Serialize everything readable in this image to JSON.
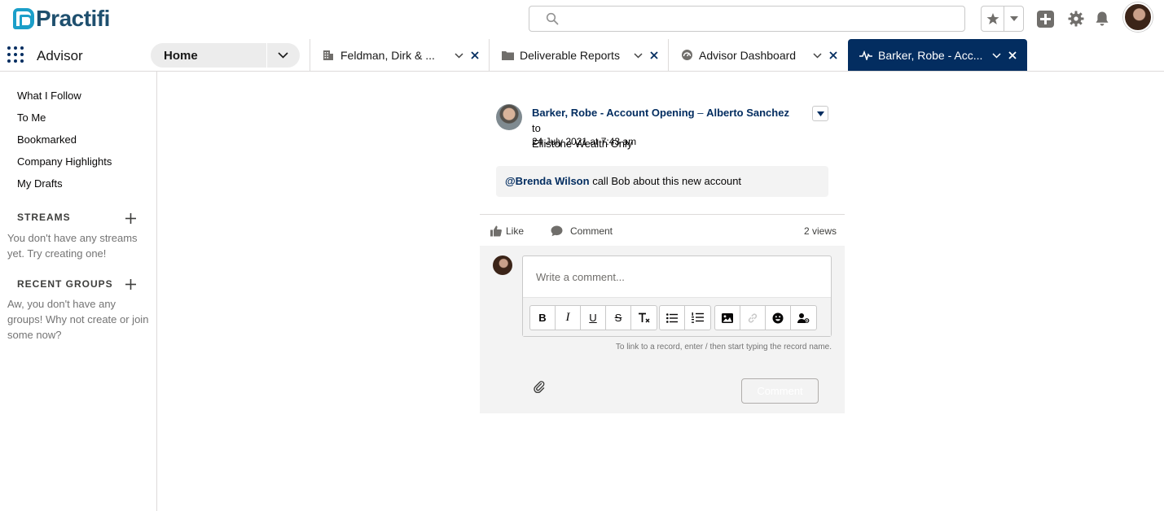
{
  "brand": {
    "name": "Practifi"
  },
  "header": {
    "search_placeholder": "",
    "icons": [
      "search-icon",
      "star-icon",
      "chevron-down-icon",
      "add-icon",
      "gear-icon",
      "bell-icon",
      "avatar"
    ]
  },
  "nav": {
    "app_name": "Advisor",
    "home_tab": "Home",
    "tabs": [
      {
        "label": "Feldman, Dirk & ...",
        "icon": "building-icon"
      },
      {
        "label": "Deliverable Reports",
        "icon": "folder-icon"
      },
      {
        "label": "Advisor Dashboard",
        "icon": "dashboard-icon"
      },
      {
        "label": "Barker, Robe - Acc...",
        "icon": "pulse-icon",
        "active": true
      }
    ]
  },
  "sidebar": {
    "links": [
      "What I Follow",
      "To Me",
      "Bookmarked",
      "Company Highlights",
      "My Drafts"
    ],
    "streams_heading": "STREAMS",
    "streams_empty": "You don't have any streams yet. Try creating one!",
    "groups_heading": "RECENT GROUPS",
    "groups_empty": "Aw, you don't have any groups! Why not create or join some now?"
  },
  "post": {
    "author_record": "Barker, Robe - Account Opening",
    "dash": "–",
    "author": "Alberto Sanchez",
    "to": "to",
    "audience": "Ellistone Wealth Only",
    "date": "24 July 2021 at 7:43 am",
    "mention": "@Brenda Wilson",
    "body": "call Bob about this new account",
    "like_label": "Like",
    "comment_label": "Comment",
    "views": "2 views"
  },
  "composer": {
    "placeholder": "Write a comment...",
    "toolbar": {
      "bold": "B",
      "italic": "I",
      "underline": "U",
      "strike": "S",
      "clear": "T"
    },
    "hint": "To link to a record, enter / then start typing the record name.",
    "submit_label": "Comment"
  },
  "colors": {
    "brand_navy": "#032d60",
    "logo_teal": "#1b9fc9",
    "border": "#dddbda",
    "panel": "#f3f3f3"
  }
}
